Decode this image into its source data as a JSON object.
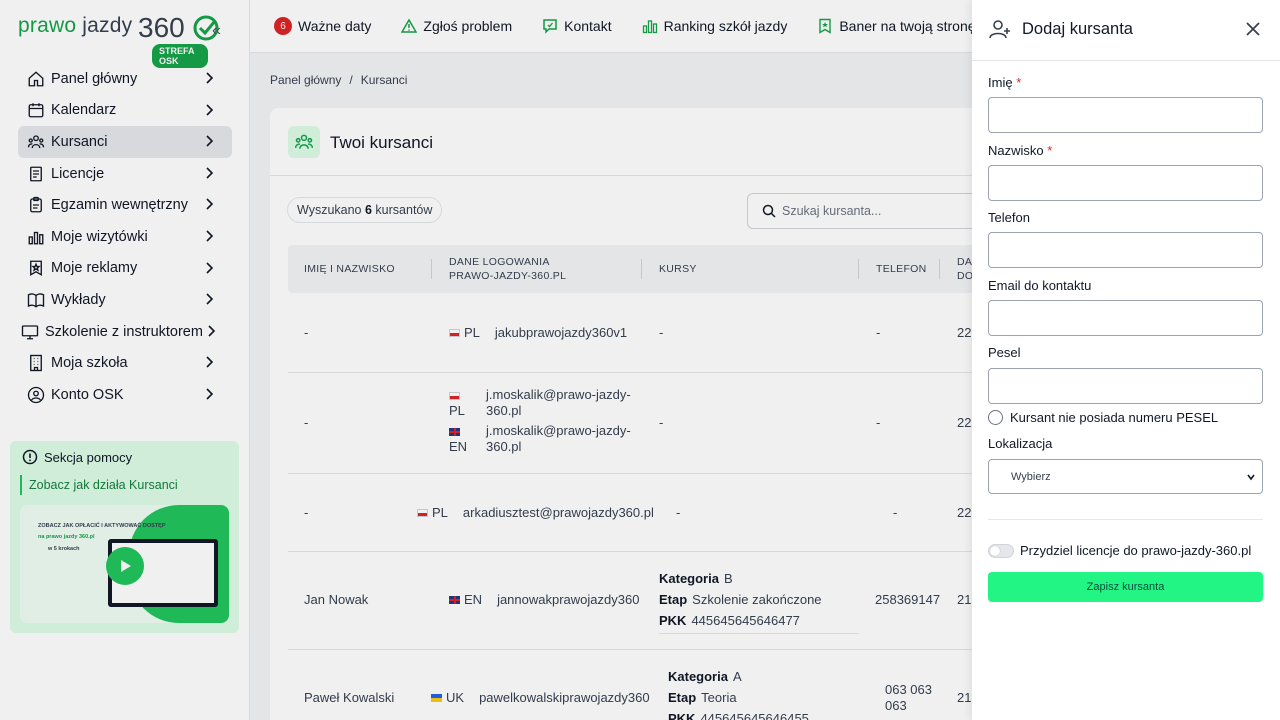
{
  "logo": {
    "brand_a": "prawo",
    "brand_b": "jazdy",
    "number": "360",
    "badge": "STREFA OSK"
  },
  "sidebar": {
    "items": [
      {
        "label": "Panel główny",
        "icon": "home-icon"
      },
      {
        "label": "Kalendarz",
        "icon": "calendar-icon"
      },
      {
        "label": "Kursanci",
        "icon": "users-icon",
        "active": true
      },
      {
        "label": "Licencje",
        "icon": "document-icon"
      },
      {
        "label": "Egzamin wewnętrzny",
        "icon": "clipboard-icon"
      },
      {
        "label": "Moje wizytówki",
        "icon": "bar-chart-icon"
      },
      {
        "label": "Moje reklamy",
        "icon": "star-badge-icon"
      },
      {
        "label": "Wykłady",
        "icon": "book-icon"
      },
      {
        "label": "Szkolenie z instruktorem",
        "icon": "monitor-icon"
      },
      {
        "label": "Moja szkoła",
        "icon": "building-icon"
      },
      {
        "label": "Konto OSK",
        "icon": "user-circle-icon"
      }
    ],
    "help": {
      "title": "Sekcja pomocy",
      "link": "Zobacz jak działa Kursanci",
      "video_text": "ZOBACZ JAK OPŁACIĆ I AKTYWOWAĆ DOSTĘP",
      "video_sub": "na prawo jazdy 360.pl",
      "video_steps": "w 5 krokach"
    }
  },
  "topbar": {
    "items": [
      {
        "label": "Ważne daty",
        "badge": "6"
      },
      {
        "label": "Zgłoś problem"
      },
      {
        "label": "Kontakt"
      },
      {
        "label": "Ranking szkół jazdy"
      },
      {
        "label": "Baner na twoją stronę"
      }
    ]
  },
  "breadcrumb": {
    "home": "Panel główny",
    "separator": "/",
    "current": "Kursanci"
  },
  "card": {
    "title": "Twoi kursanci",
    "found_prefix": "Wyszukano",
    "found_count": "6",
    "found_suffix": "kursantów",
    "search_placeholder": "Szukaj kursanta..."
  },
  "table": {
    "headers": {
      "name": "IMIĘ I NAZWISKO",
      "login_line1": "DANE LOGOWANIA",
      "login_line2": "PRAWO-JAZDY-360.PL",
      "courses": "KURSY",
      "phone": "TELEFON",
      "date_line1": "DA",
      "date_line2": "DO"
    },
    "rows": [
      {
        "name": "-",
        "lang": "PL",
        "login": "jakubprawojazdy360v1",
        "courses": "-",
        "phone": "-",
        "date": "22"
      },
      {
        "name": "-",
        "lang": "PL",
        "login": "j.moskalik@prawo-jazdy-360.pl",
        "login_a": "j.moskalik@prawo-jazdy-",
        "login_b": "360.pl",
        "lang2": "EN",
        "login2_a": "j.moskalik@prawo-jazdy-",
        "login2_b": "360.pl",
        "courses": "-",
        "phone": "-",
        "date": "22"
      },
      {
        "name": "-",
        "lang": "PL",
        "login": "arkadiusztest@prawojazdy360.pl",
        "courses": "-",
        "phone": "-",
        "date": "22"
      },
      {
        "name": "Jan Nowak",
        "lang": "EN",
        "login": "jannowakprawojazdy360",
        "k_label": "Kategoria",
        "k_val": "B",
        "e_label": "Etap",
        "e_val": "Szkolenie zakończone",
        "p_label": "PKK",
        "p_val": "445645645646477",
        "phone": "258369147",
        "date": "21-"
      },
      {
        "name": "Paweł Kowalski",
        "lang": "UK",
        "login": "pawelkowalskiprawojazdy360",
        "k_label": "Kategoria",
        "k_val": "A",
        "e_label": "Etap",
        "e_val": "Teoria",
        "p_label": "PKK",
        "p_val": "445645645646455",
        "phone_a": "063 063",
        "phone_b": "063",
        "date": "21-"
      }
    ]
  },
  "drawer": {
    "title": "Dodaj kursanta",
    "fields": {
      "first_name": "Imię",
      "last_name": "Nazwisko",
      "phone": "Telefon",
      "email": "Email do kontaktu",
      "pesel": "Pesel",
      "required_mark": "*"
    },
    "no_pesel_label": "Kursant nie posiada numeru PESEL",
    "location_label": "Lokalizacja",
    "location_value": "Wybierz",
    "license_toggle_label": "Przydziel licencje do prawo-jazdy-360.pl",
    "save_label": "Zapisz kursanta"
  },
  "colors": {
    "accent": "#16a34a",
    "button": "#22f583",
    "badge": "#dc2626"
  }
}
